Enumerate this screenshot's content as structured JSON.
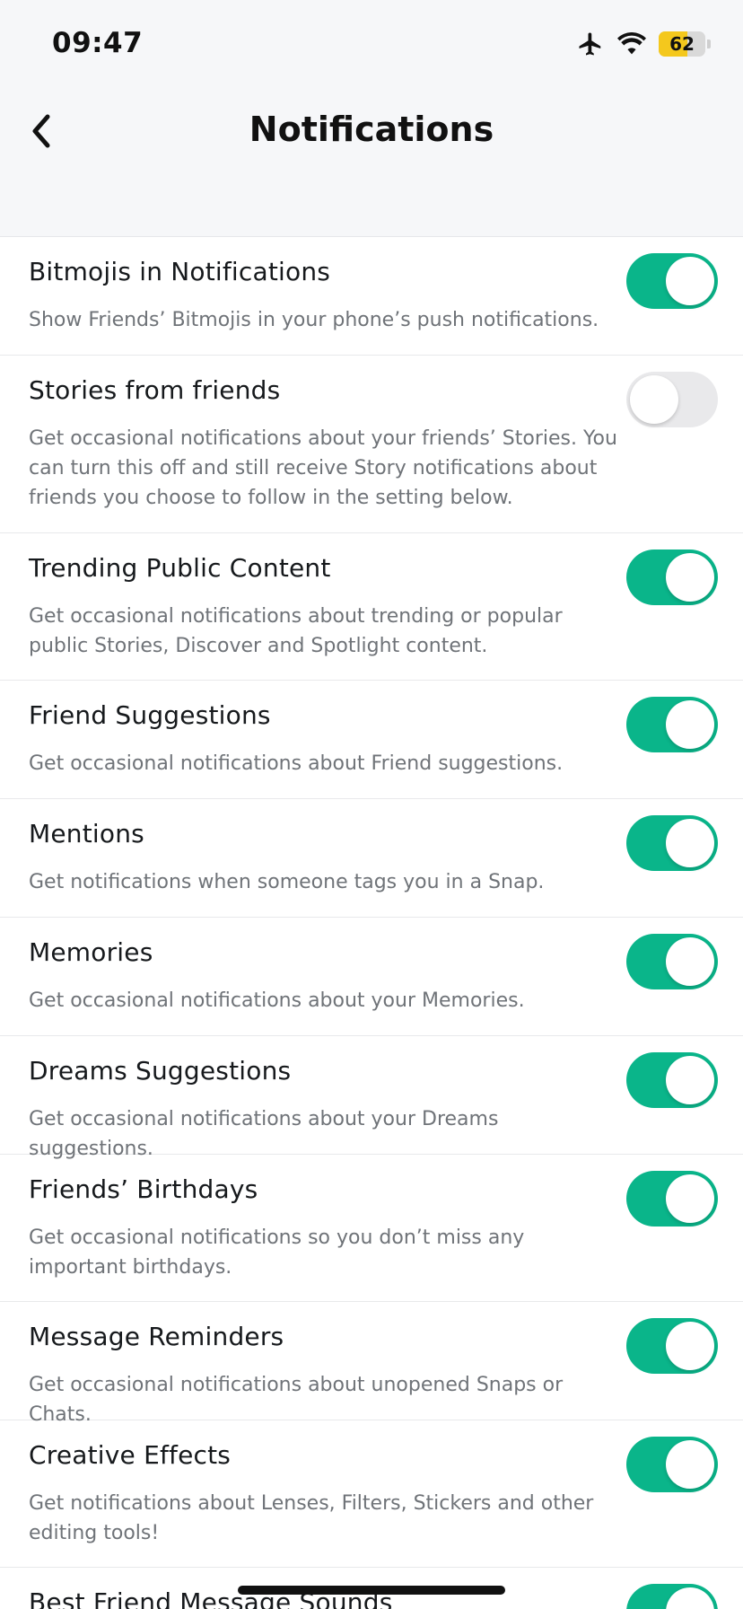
{
  "status_bar": {
    "time": "09:47",
    "battery_level": "62"
  },
  "header": {
    "title": "Notifications"
  },
  "colors": {
    "toggle_on": "#0ab58a",
    "toggle_off": "#e9e9eb",
    "battery_fill": "#f4c81d"
  },
  "icons": {
    "back": "chevron-left-icon",
    "airplane": "airplane-icon",
    "wifi": "wifi-icon",
    "battery": "battery-icon"
  },
  "settings": [
    {
      "title": "Bitmojis in Notifications",
      "description": "Show Friends’ Bitmojis in your phone’s push notifications.",
      "enabled": true
    },
    {
      "title": "Stories from friends",
      "description": "Get occasional notifications about your friends’ Stories. You can turn this off and still receive Story notifications about friends you choose to follow in the setting below.",
      "enabled": false
    },
    {
      "title": "Trending Public Content",
      "description": "Get occasional notifications about trending or popular public Stories, Discover and Spotlight content.",
      "enabled": true
    },
    {
      "title": "Friend Suggestions",
      "description": "Get occasional notifications about Friend suggestions.",
      "enabled": true
    },
    {
      "title": "Mentions",
      "description": "Get notifications when someone tags you in a Snap.",
      "enabled": true
    },
    {
      "title": "Memories",
      "description": "Get occasional notifications about your Memories.",
      "enabled": true
    },
    {
      "title": "Dreams Suggestions",
      "description": "Get occasional notifications about your Dreams suggestions.",
      "enabled": true
    },
    {
      "title": "Friends’ Birthdays",
      "description": "Get occasional notifications so you don’t miss any important birthdays.",
      "enabled": true
    },
    {
      "title": "Message Reminders",
      "description": "Get occasional notifications about unopened Snaps or Chats.",
      "enabled": true
    },
    {
      "title": "Creative Effects",
      "description": "Get notifications about Lenses, Filters, Stickers and other editing tools!",
      "enabled": true
    },
    {
      "title": "Best Friend Message Sounds",
      "description": "",
      "enabled": true
    }
  ]
}
